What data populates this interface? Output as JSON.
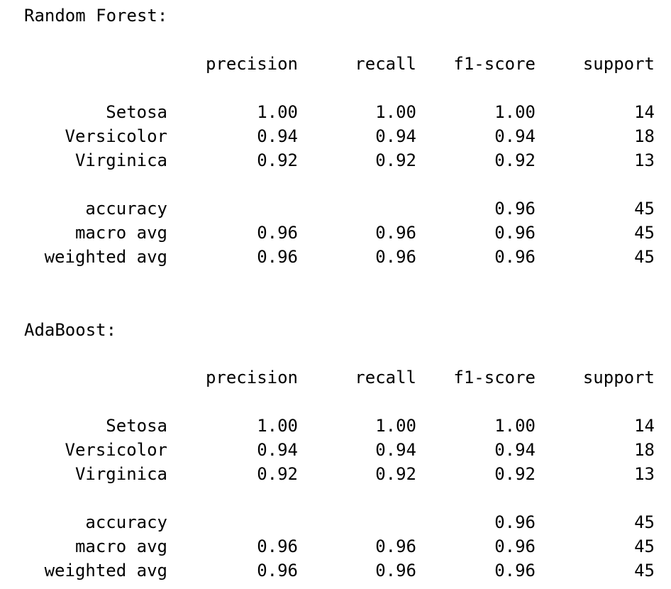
{
  "reports": [
    {
      "title": "Random Forest:",
      "header": {
        "precision": "precision",
        "recall": "recall",
        "f1": "f1-score",
        "support": "support"
      },
      "classes": [
        {
          "label": "Setosa",
          "precision": "1.00",
          "recall": "1.00",
          "f1": "1.00",
          "support": "14"
        },
        {
          "label": "Versicolor",
          "precision": "0.94",
          "recall": "0.94",
          "f1": "0.94",
          "support": "18"
        },
        {
          "label": "Virginica",
          "precision": "0.92",
          "recall": "0.92",
          "f1": "0.92",
          "support": "13"
        }
      ],
      "summary": [
        {
          "label": "accuracy",
          "precision": "",
          "recall": "",
          "f1": "0.96",
          "support": "45"
        },
        {
          "label": "macro avg",
          "precision": "0.96",
          "recall": "0.96",
          "f1": "0.96",
          "support": "45"
        },
        {
          "label": "weighted avg",
          "precision": "0.96",
          "recall": "0.96",
          "f1": "0.96",
          "support": "45"
        }
      ]
    },
    {
      "title": "AdaBoost:",
      "header": {
        "precision": "precision",
        "recall": "recall",
        "f1": "f1-score",
        "support": "support"
      },
      "classes": [
        {
          "label": "Setosa",
          "precision": "1.00",
          "recall": "1.00",
          "f1": "1.00",
          "support": "14"
        },
        {
          "label": "Versicolor",
          "precision": "0.94",
          "recall": "0.94",
          "f1": "0.94",
          "support": "18"
        },
        {
          "label": "Virginica",
          "precision": "0.92",
          "recall": "0.92",
          "f1": "0.92",
          "support": "13"
        }
      ],
      "summary": [
        {
          "label": "accuracy",
          "precision": "",
          "recall": "",
          "f1": "0.96",
          "support": "45"
        },
        {
          "label": "macro avg",
          "precision": "0.96",
          "recall": "0.96",
          "f1": "0.96",
          "support": "45"
        },
        {
          "label": "weighted avg",
          "precision": "0.96",
          "recall": "0.96",
          "f1": "0.96",
          "support": "45"
        }
      ]
    }
  ]
}
